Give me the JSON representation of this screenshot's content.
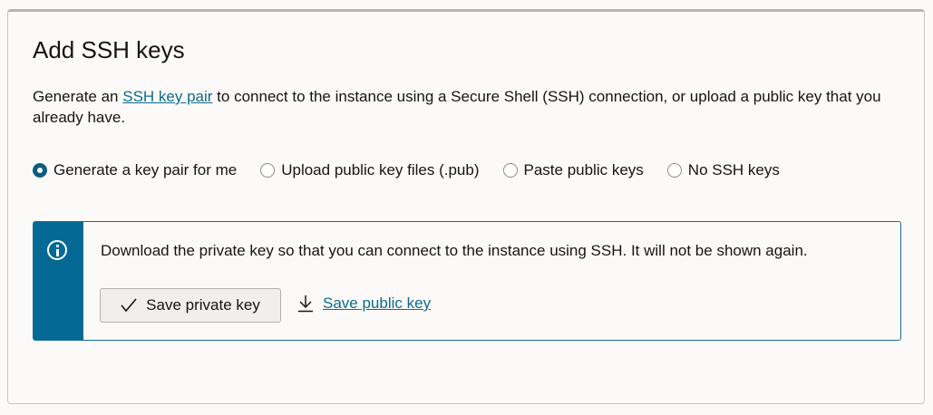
{
  "panel": {
    "title": "Add SSH keys",
    "description": {
      "prefix": "Generate an ",
      "link": "SSH key pair",
      "suffix": " to connect to the instance using a Secure Shell (SSH) connection, or upload a public key that you already have."
    }
  },
  "radios": {
    "selected": "generate",
    "options": [
      {
        "id": "generate",
        "label": "Generate a key pair for me"
      },
      {
        "id": "upload",
        "label": "Upload public key files (.pub)"
      },
      {
        "id": "paste",
        "label": "Paste public keys"
      },
      {
        "id": "none",
        "label": "No SSH keys"
      }
    ]
  },
  "info": {
    "icon": "info-icon",
    "message": "Download the private key so that you can connect to the instance using SSH. It will not be shown again.",
    "save_private_label": "Save private key",
    "save_private_icon": "checkmark-icon",
    "save_public_label": "Save public key",
    "save_public_icon": "download-icon"
  },
  "colors": {
    "accent": "#046995",
    "link": "#0e6b8f",
    "radio_selected": "#0d5b80"
  }
}
